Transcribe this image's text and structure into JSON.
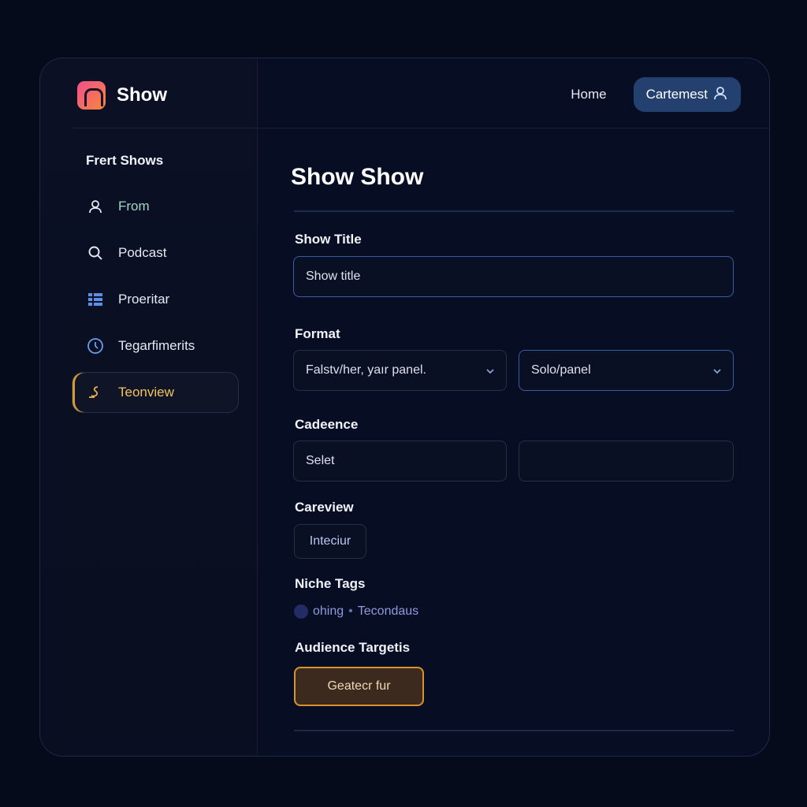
{
  "app": {
    "brand": "Show"
  },
  "header": {
    "home_label": "Home",
    "account_label": "Cartemest"
  },
  "sidebar": {
    "heading": "Frert Shows",
    "items": [
      {
        "label": "From",
        "icon": "user-icon"
      },
      {
        "label": "Podcast",
        "icon": "search-icon"
      },
      {
        "label": "Proeritar",
        "icon": "grid-icon"
      },
      {
        "label": "Tegarfimerits",
        "icon": "clock-icon"
      },
      {
        "label": "Teonview",
        "icon": "signature-icon",
        "active": true
      }
    ]
  },
  "form": {
    "title": "Show Show",
    "show_title": {
      "label": "Show Title",
      "value": "Show title"
    },
    "format": {
      "label": "Format",
      "option_1": "Falstv/her, yaır panel.",
      "option_2": "Solo/panel"
    },
    "cadence": {
      "label": "Cadeence",
      "select_placeholder": "Selet"
    },
    "careview": {
      "label": "Careview",
      "button": "Inteciur"
    },
    "niche_tags": {
      "label": "Niche Tags",
      "tag_1": "ohing",
      "tag_2": "Tecondaus"
    },
    "audience": {
      "label": "Audience Targetis",
      "button": "Geatecr fur"
    }
  },
  "colors": {
    "accent": "#d7932e",
    "primary": "#24406e",
    "background": "#060b1c"
  }
}
